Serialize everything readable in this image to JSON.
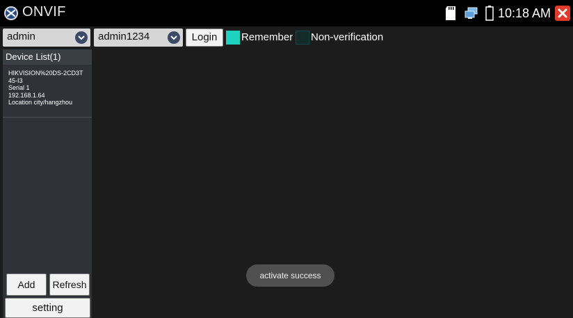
{
  "header": {
    "app_title": "ONVIF",
    "clock": "10:18 AM"
  },
  "toolbar": {
    "username": "admin",
    "password": "admin1234",
    "login_label": "Login",
    "remember_label": "Remember",
    "remember_checked": true,
    "nonverify_label": "Non-verification",
    "nonverify_checked": false
  },
  "sidebar": {
    "title": "Device List(1)",
    "devices": [
      {
        "name_line1": "HIKVISION%20DS-2CD3T",
        "name_line2": "45-I3",
        "serial": "Serial 1",
        "ip": "192.168.1.64",
        "location": "Location city/hangzhou"
      }
    ],
    "add_label": "Add",
    "refresh_label": "Refresh",
    "setting_label": "setting"
  },
  "toast": {
    "message": "activate success"
  },
  "colors": {
    "accent": "#1ed1c1",
    "close": "#e23a2b",
    "sidebar": "#2f3337",
    "background": "#1c1c1c"
  },
  "icons": [
    "onvif-logo-icon",
    "sd-card-icon",
    "network-icon",
    "battery-icon",
    "close-icon",
    "chevron-down-icon"
  ]
}
